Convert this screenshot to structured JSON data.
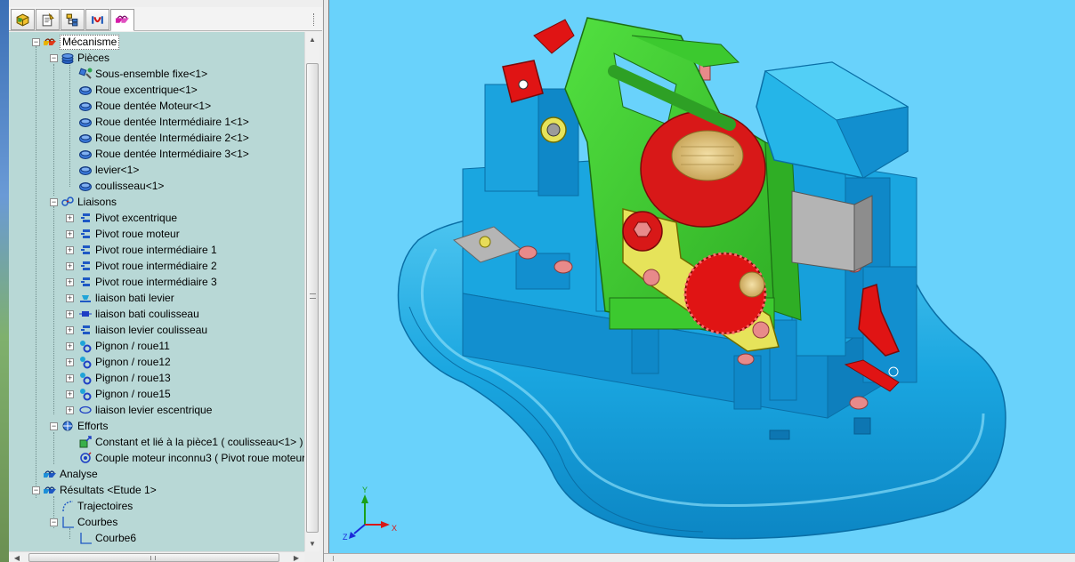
{
  "toolbar": {
    "tabs": [
      {
        "icon": "feature-manager-icon"
      },
      {
        "icon": "property-manager-icon"
      },
      {
        "icon": "configuration-manager-icon"
      },
      {
        "icon": "dimxpert-icon"
      },
      {
        "icon": "mechanism-tree-icon",
        "active": true
      }
    ]
  },
  "tree": {
    "root_label": "Mécanisme",
    "parts": {
      "label": "Pièces",
      "items": [
        "Sous-ensemble fixe<1>",
        "Roue excentrique<1>",
        "Roue dentée Moteur<1>",
        "Roue dentée Intermédiaire 1<1>",
        "Roue dentée Intermédiaire 2<1>",
        "Roue dentée Intermédiaire 3<1>",
        "levier<1>",
        "coulisseau<1>"
      ]
    },
    "links": {
      "label": "Liaisons",
      "items": [
        {
          "label": "Pivot excentrique",
          "icon": "pivot-icon"
        },
        {
          "label": "Pivot roue moteur",
          "icon": "pivot-icon"
        },
        {
          "label": "Pivot roue intermédiaire 1",
          "icon": "pivot-icon"
        },
        {
          "label": "Pivot roue intermédiaire 2",
          "icon": "pivot-icon"
        },
        {
          "label": "Pivot roue intermédiaire 3",
          "icon": "pivot-icon"
        },
        {
          "label": "liaison bati levier",
          "icon": "planar-link-icon"
        },
        {
          "label": "liaison bati coulisseau",
          "icon": "slider-link-icon"
        },
        {
          "label": "liaison levier coulisseau",
          "icon": "pivot-icon"
        },
        {
          "label": "Pignon / roue11",
          "icon": "gear-pair-icon"
        },
        {
          "label": "Pignon / roue12",
          "icon": "gear-pair-icon"
        },
        {
          "label": "Pignon / roue13",
          "icon": "gear-pair-icon"
        },
        {
          "label": "Pignon / roue15",
          "icon": "gear-pair-icon"
        },
        {
          "label": "liaison levier escentrique",
          "icon": "ellipse-link-icon"
        }
      ]
    },
    "efforts": {
      "label": "Efforts",
      "items": [
        "Constant et lié à la pièce1 ( coulisseau<1> )",
        "Couple moteur inconnu3 ( Pivot roue moteur"
      ]
    },
    "analysis_label": "Analyse",
    "results": {
      "label": "Résultats <Etude 1>",
      "trajectories_label": "Trajectoires",
      "curves_label": "Courbes",
      "curve_item": "Courbe6"
    }
  },
  "viewport": {
    "background": "#69d2fb",
    "triad": {
      "x": "X",
      "y": "Y",
      "z": "Z"
    },
    "colors": {
      "base": "#18a9e0",
      "frame": "#3fcf33",
      "red": "#e01414",
      "yellow": "#e6e35a",
      "gear_gold": "#e8c97a",
      "grey": "#b5b5b5"
    }
  }
}
